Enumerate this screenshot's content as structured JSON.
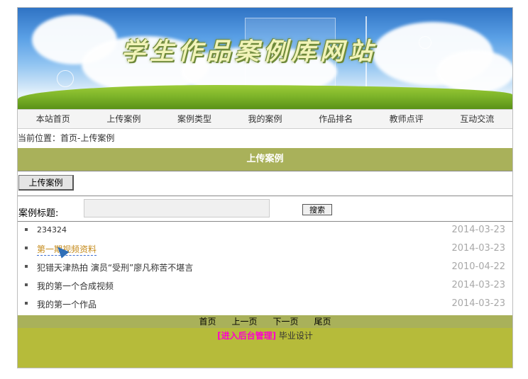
{
  "banner": {
    "title": "学生作品案例库网站"
  },
  "nav": {
    "items": [
      "本站首页",
      "上传案例",
      "案例类型",
      "我的案例",
      "作品排名",
      "教师点评",
      "互动交流"
    ]
  },
  "breadcrumb": "当前位置：首页-上传案例",
  "section_title": "上传案例",
  "upload_button": "上传案例",
  "search": {
    "label": "案例标题:",
    "value": "",
    "button": "搜索"
  },
  "cases": [
    {
      "title": "234324",
      "date": "2014-03-23"
    },
    {
      "title": "第一期视频资料",
      "date": "2014-03-23"
    },
    {
      "title": "犯错天津热拍 演员“受刑”廖凡称苦不堪言",
      "date": "2010-04-22"
    },
    {
      "title": "我的第一个合成视频",
      "date": "2014-03-23"
    },
    {
      "title": "我的第一个作品",
      "date": "2014-03-23"
    }
  ],
  "pager": {
    "first": "首页",
    "prev": "上一页",
    "next": "下一页",
    "last": "尾页"
  },
  "footer": {
    "admin_link": "[进入后台管理]",
    "text": "毕业设计"
  }
}
